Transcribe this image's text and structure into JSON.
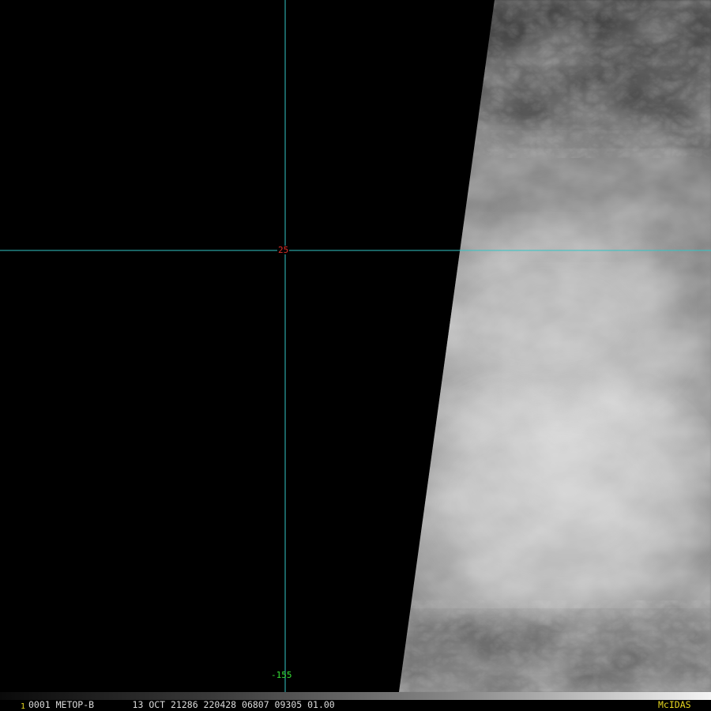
{
  "image": {
    "description_colors": {
      "background": "#000000",
      "gridline": "#33c6c6",
      "latitude_label": "#e0302a",
      "longitude_label": "#35e035",
      "footer_text": "#dcdcdc",
      "accent_yellow": "#e8d820"
    }
  },
  "grid": {
    "latitude_label": "25",
    "longitude_label": "-155"
  },
  "footer": {
    "frame_number": "1",
    "status_text": "0001 METOP-B       13 OCT 21286 220428 06807 09305 01.00",
    "product": "McIDAS"
  }
}
